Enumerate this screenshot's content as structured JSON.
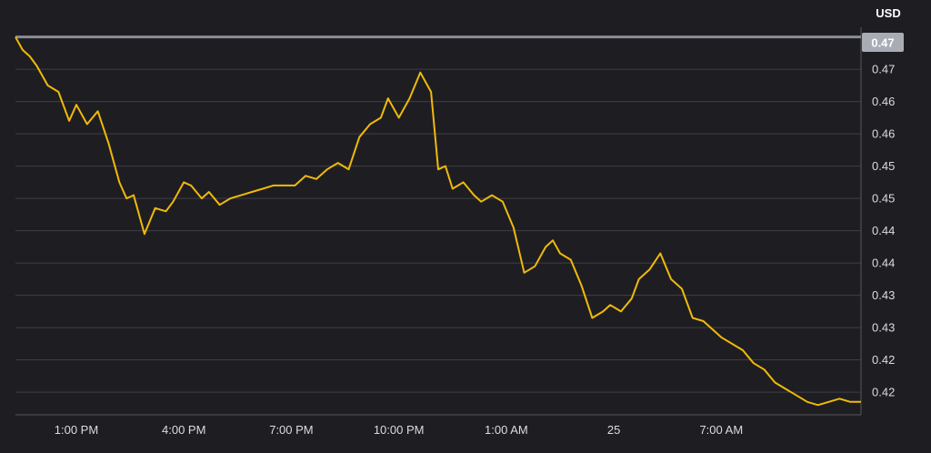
{
  "chart_data": {
    "type": "line",
    "unit": "USD",
    "current_value_label": "0.47",
    "colors": {
      "background": "#1e1e22",
      "line": "#f0b90b",
      "reference_line": "#8a8d96",
      "badge": "#a9acb4"
    },
    "grid": true,
    "y_tick_labels": [
      "0.47",
      "0.46",
      "0.46",
      "0.45",
      "0.45",
      "0.44",
      "0.44",
      "0.43",
      "0.43",
      "0.42",
      "0.42"
    ],
    "y_tick_values": [
      0.4725,
      0.4675,
      0.4625,
      0.4575,
      0.4525,
      0.4475,
      0.4425,
      0.4375,
      0.4325,
      0.4275,
      0.4225
    ],
    "ylim": [
      0.419,
      0.479
    ],
    "x_tick_labels": [
      "1:00 PM",
      "4:00 PM",
      "7:00 PM",
      "10:00 PM",
      "1:00 AM",
      "25",
      "7:00 AM"
    ],
    "x_tick_positions": [
      2.0,
      5.0,
      8.0,
      11.0,
      14.0,
      17.0,
      20.0
    ],
    "xlim": [
      0.3,
      23.9
    ],
    "reference_value": 0.4775,
    "series": [
      {
        "x": [
          0.3,
          0.5,
          0.7,
          0.9,
          1.2,
          1.5,
          1.8,
          2.0,
          2.3,
          2.6,
          2.9,
          3.2,
          3.4,
          3.6,
          3.9,
          4.2,
          4.5,
          4.7,
          5.0,
          5.2,
          5.5,
          5.7,
          6.0,
          6.3,
          6.6,
          6.9,
          7.2,
          7.5,
          7.8,
          8.1,
          8.4,
          8.7,
          9.0,
          9.3,
          9.6,
          9.9,
          10.2,
          10.5,
          10.7,
          11.0,
          11.3,
          11.6,
          11.9,
          12.1,
          12.3,
          12.5,
          12.8,
          13.1,
          13.3,
          13.6,
          13.9,
          14.2,
          14.5,
          14.8,
          15.1,
          15.3,
          15.5,
          15.8,
          16.1,
          16.4,
          16.7,
          16.9,
          17.2,
          17.5,
          17.7,
          18.0,
          18.3,
          18.6,
          18.9,
          19.2,
          19.5,
          19.7,
          20.0,
          20.3,
          20.6,
          20.9,
          21.2,
          21.5,
          21.8,
          22.1,
          22.4,
          22.7,
          23.0,
          23.3,
          23.6,
          23.9
        ],
        "y": [
          0.4775,
          0.4755,
          0.4745,
          0.473,
          0.47,
          0.469,
          0.4645,
          0.467,
          0.464,
          0.466,
          0.461,
          0.455,
          0.4525,
          0.453,
          0.447,
          0.451,
          0.4505,
          0.452,
          0.455,
          0.4545,
          0.4525,
          0.4535,
          0.4515,
          0.4525,
          0.453,
          0.4535,
          0.454,
          0.4545,
          0.4545,
          0.4545,
          0.456,
          0.4555,
          0.457,
          0.458,
          0.457,
          0.462,
          0.464,
          0.465,
          0.468,
          0.465,
          0.468,
          0.472,
          0.469,
          0.457,
          0.4575,
          0.454,
          0.455,
          0.453,
          0.452,
          0.453,
          0.452,
          0.448,
          0.441,
          0.442,
          0.445,
          0.446,
          0.444,
          0.443,
          0.439,
          0.434,
          0.435,
          0.436,
          0.435,
          0.437,
          0.44,
          0.4415,
          0.444,
          0.44,
          0.4385,
          0.434,
          0.4335,
          0.4325,
          0.431,
          0.43,
          0.429,
          0.427,
          0.426,
          0.424,
          0.423,
          0.422,
          0.421,
          0.4205,
          0.421,
          0.4215,
          0.421,
          0.421
        ]
      }
    ]
  }
}
